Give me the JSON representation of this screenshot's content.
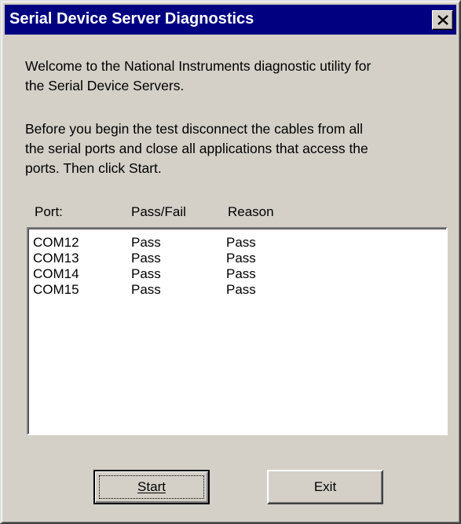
{
  "window": {
    "title": "Serial Device Server Diagnostics"
  },
  "intro": {
    "paragraph1": "Welcome to the National Instruments diagnostic utility for\nthe Serial Device Servers.",
    "paragraph2": "Before you begin the test disconnect the cables from all\nthe serial ports and close all applications that access the\nports.  Then click Start."
  },
  "results": {
    "columns": [
      "Port:",
      "Pass/Fail",
      "Reason"
    ],
    "rows": [
      {
        "port": "COM12",
        "status": "Pass",
        "reason": "Pass"
      },
      {
        "port": "COM13",
        "status": "Pass",
        "reason": "Pass"
      },
      {
        "port": "COM14",
        "status": "Pass",
        "reason": "Pass"
      },
      {
        "port": "COM15",
        "status": "Pass",
        "reason": "Pass"
      }
    ]
  },
  "buttons": {
    "start_label": "Start",
    "exit_label": "Exit"
  },
  "colors": {
    "titlebar": "#000080",
    "face": "#d4d0c8"
  }
}
